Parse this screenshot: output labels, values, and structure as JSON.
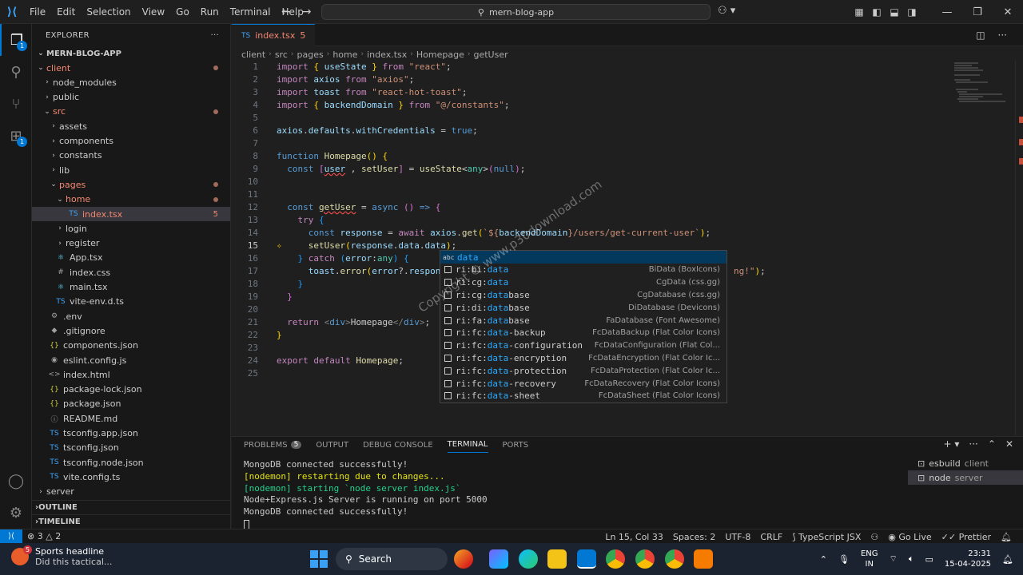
{
  "titlebar": {
    "menu": [
      "File",
      "Edit",
      "Selection",
      "View",
      "Go",
      "Run",
      "Terminal",
      "Help"
    ],
    "search": "mern-blog-app"
  },
  "sidebar": {
    "header": "EXPLORER",
    "project": "MERN-BLOG-APP",
    "tree": [
      {
        "label": "client",
        "depth": 1,
        "chev": "v",
        "status": "dot",
        "red": true
      },
      {
        "label": "node_modules",
        "depth": 2,
        "chev": ">"
      },
      {
        "label": "public",
        "depth": 2,
        "chev": ">"
      },
      {
        "label": "src",
        "depth": 2,
        "chev": "v",
        "status": "dot",
        "red": true
      },
      {
        "label": "assets",
        "depth": 3,
        "chev": ">"
      },
      {
        "label": "components",
        "depth": 3,
        "chev": ">"
      },
      {
        "label": "constants",
        "depth": 3,
        "chev": ">"
      },
      {
        "label": "lib",
        "depth": 3,
        "chev": ">"
      },
      {
        "label": "pages",
        "depth": 3,
        "chev": "v",
        "status": "dot",
        "red": true
      },
      {
        "label": "home",
        "depth": 4,
        "chev": "v",
        "status": "dot",
        "red": true
      },
      {
        "label": "index.tsx",
        "depth": 5,
        "icon": "TS",
        "status": "5",
        "red": true,
        "selected": true
      },
      {
        "label": "login",
        "depth": 4,
        "chev": ">"
      },
      {
        "label": "register",
        "depth": 4,
        "chev": ">"
      },
      {
        "label": "App.tsx",
        "depth": 3,
        "icon": "⚛"
      },
      {
        "label": "index.css",
        "depth": 3,
        "icon": "#"
      },
      {
        "label": "main.tsx",
        "depth": 3,
        "icon": "⚛"
      },
      {
        "label": "vite-env.d.ts",
        "depth": 3,
        "icon": "TS"
      },
      {
        "label": ".env",
        "depth": 2,
        "icon": "⚙"
      },
      {
        "label": ".gitignore",
        "depth": 2,
        "icon": "◆"
      },
      {
        "label": "components.json",
        "depth": 2,
        "icon": "{}"
      },
      {
        "label": "eslint.config.js",
        "depth": 2,
        "icon": "◉"
      },
      {
        "label": "index.html",
        "depth": 2,
        "icon": "<>"
      },
      {
        "label": "package-lock.json",
        "depth": 2,
        "icon": "{}"
      },
      {
        "label": "package.json",
        "depth": 2,
        "icon": "{}"
      },
      {
        "label": "README.md",
        "depth": 2,
        "icon": "ⓘ"
      },
      {
        "label": "tsconfig.app.json",
        "depth": 2,
        "icon": "TS"
      },
      {
        "label": "tsconfig.json",
        "depth": 2,
        "icon": "TS"
      },
      {
        "label": "tsconfig.node.json",
        "depth": 2,
        "icon": "TS"
      },
      {
        "label": "vite.config.ts",
        "depth": 2,
        "icon": "TS"
      },
      {
        "label": "server",
        "depth": 1,
        "chev": ">"
      }
    ],
    "outline": "OUTLINE",
    "timeline": "TIMELINE"
  },
  "editor": {
    "tab": {
      "label": "index.tsx",
      "count": "5"
    },
    "breadcrumb": [
      "client",
      "src",
      "pages",
      "home",
      "index.tsx",
      "Homepage",
      "getUser"
    ],
    "current_line": 15
  },
  "suggest": [
    {
      "prefix": "",
      "match": "data",
      "suffix": "",
      "detail": "",
      "icon": "abc"
    },
    {
      "prefix": "ri:bi:",
      "match": "data",
      "suffix": "",
      "detail": "BiData (BoxIcons)"
    },
    {
      "prefix": "ri:cg:",
      "match": "data",
      "suffix": "",
      "detail": "CgData (css.gg)"
    },
    {
      "prefix": "ri:cg:",
      "match": "data",
      "suffix": "base",
      "detail": "CgDatabase (css.gg)"
    },
    {
      "prefix": "ri:di:",
      "match": "data",
      "suffix": "base",
      "detail": "DiDatabase (Devicons)"
    },
    {
      "prefix": "ri:fa:",
      "match": "data",
      "suffix": "base",
      "detail": "FaDatabase (Font Awesome)"
    },
    {
      "prefix": "ri:fc:",
      "match": "data",
      "suffix": "-backup",
      "detail": "FcDataBackup (Flat Color Icons)"
    },
    {
      "prefix": "ri:fc:",
      "match": "data",
      "suffix": "-configuration",
      "detail": "FcDataConfiguration (Flat Col..."
    },
    {
      "prefix": "ri:fc:",
      "match": "data",
      "suffix": "-encryption",
      "detail": "FcDataEncryption (Flat Color Ic..."
    },
    {
      "prefix": "ri:fc:",
      "match": "data",
      "suffix": "-protection",
      "detail": "FcDataProtection (Flat Color Ic..."
    },
    {
      "prefix": "ri:fc:",
      "match": "data",
      "suffix": "-recovery",
      "detail": "FcDataRecovery (Flat Color Icons)"
    },
    {
      "prefix": "ri:fc:",
      "match": "data",
      "suffix": "-sheet",
      "detail": "FcDataSheet (Flat Color Icons)"
    }
  ],
  "watermark": "Copyright © www.p30download.com",
  "panel": {
    "tabs": [
      "PROBLEMS",
      "OUTPUT",
      "DEBUG CONSOLE",
      "TERMINAL",
      "PORTS"
    ],
    "problems_count": "5",
    "terminal_lines": [
      {
        "text": "MongoDB connected successfully!",
        "color": "white"
      },
      {
        "text": "[nodemon] restarting due to changes...",
        "color": "yellow"
      },
      {
        "text": "[nodemon] starting `node server index.js`",
        "color": "green"
      },
      {
        "text": "Node+Express.js Server is running on port 5000",
        "color": "white"
      },
      {
        "text": "MongoDB connected successfully!",
        "color": "white"
      }
    ],
    "terminals": [
      {
        "name": "esbuild",
        "sub": "client"
      },
      {
        "name": "node",
        "sub": "server"
      }
    ]
  },
  "statusbar": {
    "errors": "3",
    "warnings": "2",
    "position": "Ln 15, Col 33",
    "spaces": "Spaces: 2",
    "encoding": "UTF-8",
    "eol": "CRLF",
    "language": "TypeScript JSX",
    "golive": "Go Live",
    "prettier": "Prettier"
  },
  "taskbar": {
    "weather_title": "Sports headline",
    "weather_sub": "Did this tactical...",
    "weather_badge": "5",
    "search": "Search",
    "lang1": "ENG",
    "lang2": "IN",
    "time": "23:31",
    "date": "15-04-2025"
  },
  "colors": {
    "accent": "#0078d4",
    "error": "#f48771"
  }
}
